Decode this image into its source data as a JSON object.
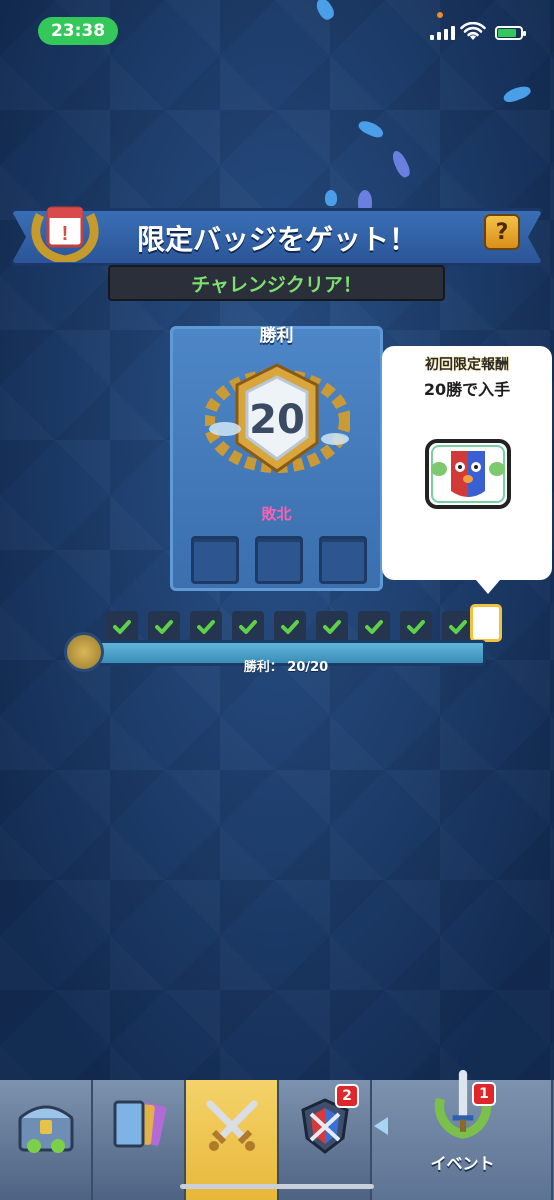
{
  "status_bar": {
    "time": "23:38"
  },
  "banner": {
    "title": "限定バッジをゲット！",
    "help_label": "?"
  },
  "subtitle": "チャレンジクリア！",
  "badge_card": {
    "title": "勝利",
    "badge_number": "20",
    "loss_label": "敗北",
    "loss_slots": 3
  },
  "reward": {
    "line1": "初回限定報酬",
    "line2": "20勝で入手"
  },
  "progress": {
    "completed_checks": 9,
    "total": 20,
    "wins": 20,
    "label": "勝利： 20/20"
  },
  "tabs": [
    {
      "name": "chest",
      "badge": ""
    },
    {
      "name": "cards",
      "badge": ""
    },
    {
      "name": "battle",
      "badge": "",
      "active": true
    },
    {
      "name": "clan",
      "badge": "2"
    },
    {
      "name": "event",
      "label": "イベント",
      "badge": "1"
    }
  ],
  "colors": {
    "accent_green": "#7ee06f",
    "loss_pink": "#ff5fb3",
    "active_tab": "#f4d36a",
    "status_pill": "#34c759"
  }
}
